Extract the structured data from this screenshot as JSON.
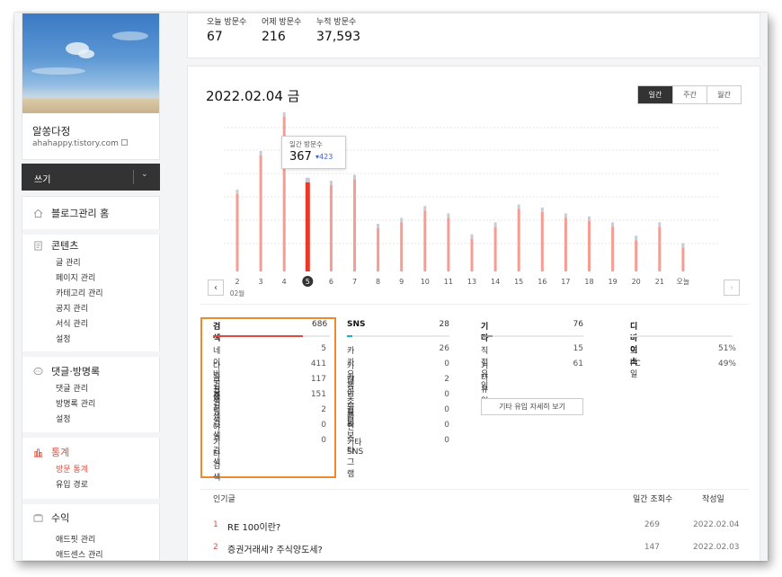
{
  "sidebar": {
    "blog_name": "알쏭다정",
    "blog_url": "ahahappy.tistory.com",
    "write_label": "쓰기",
    "menu": [
      {
        "label": "블로그관리 홈",
        "items": []
      },
      {
        "label": "콘텐츠",
        "items": [
          "글 관리",
          "페이지 관리",
          "카테고리 관리",
          "공지 관리",
          "서식 관리",
          "설정"
        ]
      },
      {
        "label": "댓글·방명록",
        "items": [
          "댓글 관리",
          "방명록 관리",
          "설정"
        ]
      },
      {
        "label": "통계",
        "items": [
          "방문 통계",
          "유입 경로"
        ]
      },
      {
        "label": "수익",
        "items": [
          "애드핏 관리",
          "애드센스 관리"
        ]
      }
    ]
  },
  "visits": {
    "today_label": "오늘 방문수",
    "today_value": "67",
    "yesterday_label": "어제 방문수",
    "yesterday_value": "216",
    "total_label": "누적 방문수",
    "total_value": "37,593"
  },
  "stats": {
    "date_title": "2022.02.04 금",
    "tabs": [
      "일간",
      "주간",
      "월간"
    ],
    "tooltip": {
      "label": "일간 방문수",
      "value": "367",
      "delta": "423"
    },
    "month_label": "02월"
  },
  "chart_data": {
    "type": "bar",
    "categories": [
      "2",
      "3",
      "4",
      "5",
      "6",
      "7",
      "8",
      "9",
      "10",
      "11",
      "13",
      "14",
      "15",
      "16",
      "17",
      "18",
      "19",
      "20",
      "21",
      "오늘"
    ],
    "selected": "5",
    "values": [
      520,
      780,
      1040,
      600,
      580,
      620,
      290,
      330,
      410,
      360,
      220,
      300,
      420,
      400,
      360,
      340,
      300,
      210,
      300,
      160
    ],
    "colors": {
      "bar": "#f59d93",
      "selected": "#e8382a",
      "grid": "#e4e4e4"
    }
  },
  "breakdown": {
    "search": {
      "title": "검색",
      "total": "686",
      "rows": [
        {
          "label": "네이버 검색",
          "value": "5"
        },
        {
          "label": "다음 검색",
          "value": "411"
        },
        {
          "label": "구글 검색",
          "value": "117"
        },
        {
          "label": "줌 검색",
          "value": "151"
        },
        {
          "label": "빙 검색",
          "value": "2"
        },
        {
          "label": "야후 검색",
          "value": "0"
        },
        {
          "label": "기타 검색",
          "value": "0"
        }
      ]
    },
    "sns": {
      "title": "SNS",
      "total": "28",
      "rows": [
        {
          "label": "카카오톡",
          "value": "26"
        },
        {
          "label": "카카오스토리",
          "value": "0"
        },
        {
          "label": "페이스북",
          "value": "2"
        },
        {
          "label": "트위터",
          "value": "0"
        },
        {
          "label": "유튜브",
          "value": "0"
        },
        {
          "label": "인스타그램",
          "value": "0"
        },
        {
          "label": "기타 SNS",
          "value": "0"
        }
      ]
    },
    "etc": {
      "title": "기타",
      "total": "76",
      "rows": [
        {
          "label": "직접 유입",
          "value": "15"
        },
        {
          "label": "기타 유입",
          "value": "61"
        }
      ],
      "button": "기타 유입 자세히 보기"
    },
    "device": {
      "title": "디바이스",
      "rows": [
        {
          "label": "모바일",
          "value": "51%"
        },
        {
          "label": "PC",
          "value": "49%"
        }
      ]
    }
  },
  "popular": {
    "title": "인기글",
    "col_views": "일간 조회수",
    "col_date": "작성일",
    "rows": [
      {
        "rank": "1",
        "name": "RE 100이란?",
        "views": "269",
        "date": "2022.02.04"
      },
      {
        "rank": "2",
        "name": "증권거래세? 주식양도세?",
        "views": "147",
        "date": "2022.02.03"
      }
    ]
  }
}
